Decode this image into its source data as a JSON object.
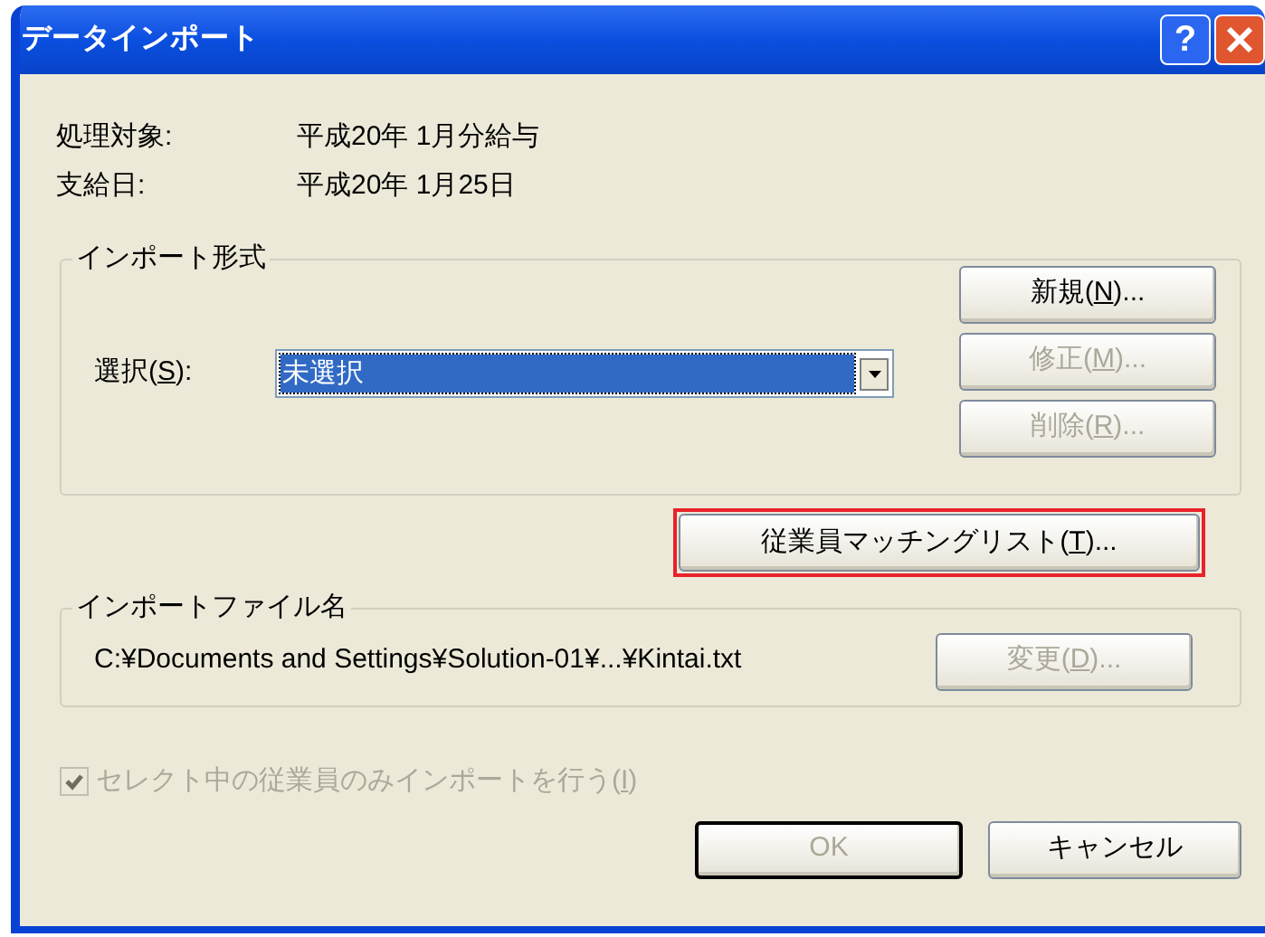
{
  "window": {
    "title": "データインポート",
    "help_button": "?"
  },
  "info": [
    {
      "label": "処理対象:",
      "value": "平成20年 1月分給与"
    },
    {
      "label": "支給日:",
      "value": "平成20年 1月25日"
    }
  ],
  "import_format": {
    "legend": "インポート形式",
    "select_label": {
      "before": "選択(",
      "mnemonic": "S",
      "after": "):"
    },
    "combo_value": "未選択",
    "buttons": [
      {
        "before": "新規(",
        "mnemonic": "N",
        "after": ")...",
        "disabled": false
      },
      {
        "before": "修正(",
        "mnemonic": "M",
        "after": ")...",
        "disabled": true
      },
      {
        "before": "削除(",
        "mnemonic": "R",
        "after": ")...",
        "disabled": true
      }
    ]
  },
  "matching_button": {
    "before": "従業員マッチングリスト(",
    "mnemonic": "T",
    "after": ")...",
    "disabled": false,
    "highlighted": true
  },
  "import_file": {
    "legend": "インポートファイル名",
    "path": "C:¥Documents and Settings¥Solution-01¥...¥Kintai.txt",
    "button": {
      "before": "変更(",
      "mnemonic": "D",
      "after": ")...",
      "disabled": true
    }
  },
  "checkbox": {
    "before": "セレクト中の従業員のみインポートを行う(",
    "mnemonic": "I",
    "after": ")",
    "checked": true,
    "disabled": true
  },
  "footer_buttons": [
    {
      "label": "OK",
      "disabled": true,
      "default": true
    },
    {
      "label": "キャンセル",
      "disabled": false,
      "default": false
    }
  ]
}
